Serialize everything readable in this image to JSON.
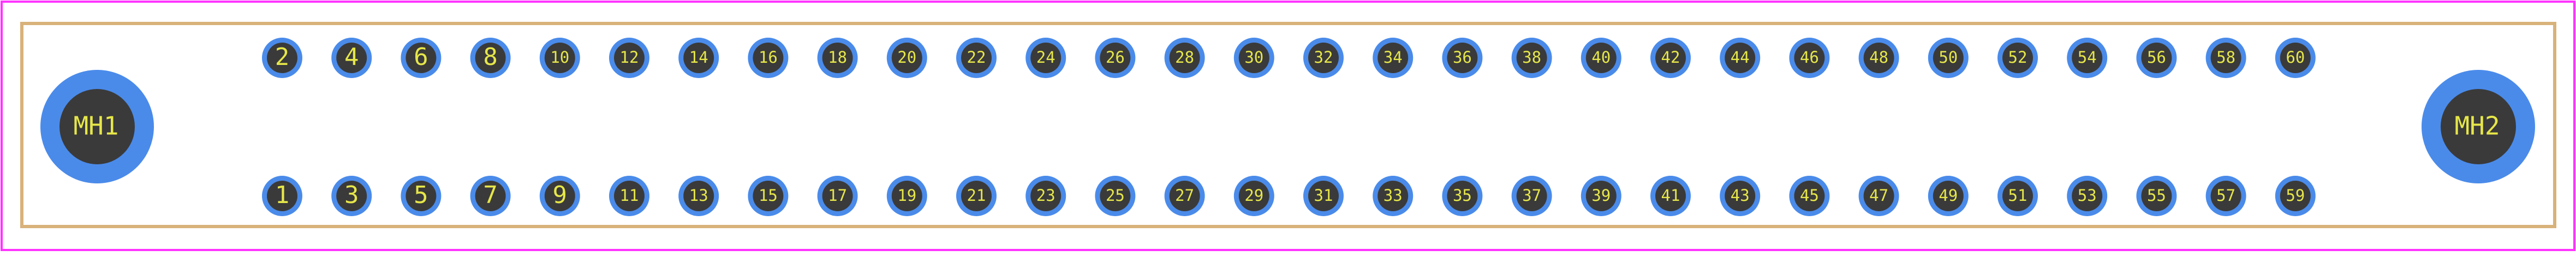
{
  "colors": {
    "background": "#ffffff",
    "courtyard": "#ff33ff",
    "silkscreen": "#d8b27a",
    "pad_copper": "#4a8bea",
    "pad_hole": "#3a3a3a",
    "pad_label": "#e6e64a"
  },
  "mounting_holes": [
    {
      "label": "MH1"
    },
    {
      "label": "MH2"
    }
  ],
  "top_row_pins": [
    "2",
    "4",
    "6",
    "8",
    "10",
    "12",
    "14",
    "16",
    "18",
    "20",
    "22",
    "24",
    "26",
    "28",
    "30",
    "32",
    "34",
    "36",
    "38",
    "40",
    "42",
    "44",
    "46",
    "48",
    "50",
    "52",
    "54",
    "56",
    "58",
    "60"
  ],
  "bottom_row_pins": [
    "1",
    "3",
    "5",
    "7",
    "9",
    "11",
    "13",
    "15",
    "17",
    "19",
    "21",
    "23",
    "25",
    "27",
    "29",
    "31",
    "33",
    "35",
    "37",
    "39",
    "41",
    "43",
    "45",
    "47",
    "49",
    "51",
    "53",
    "55",
    "57",
    "59"
  ]
}
